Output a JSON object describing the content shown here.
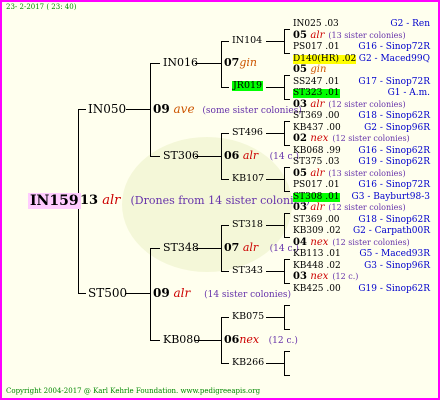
{
  "header": {
    "date": "23-  2-2017 ( 23: 40)"
  },
  "root": {
    "id": "IN159",
    "year": "13",
    "race": "alr",
    "note": "(Drones from 14 sister colonies)"
  },
  "g2": {
    "top": {
      "id": "IN050",
      "year": "09",
      "race": "ave",
      "note": "(some sister colonies)"
    },
    "bottom": {
      "id": "ST500",
      "year": "09",
      "race": "alr",
      "note": "(14 sister colonies)"
    }
  },
  "g3": [
    {
      "id": "IN016",
      "year": "07",
      "race": "gin",
      "note": ""
    },
    {
      "id": "ST306",
      "year": "06",
      "race": "alr",
      "note": "(14 c.)"
    },
    {
      "id": "ST348",
      "year": "07",
      "race": "alr",
      "note": "(14 c.)"
    },
    {
      "id": "KB080",
      "year": "06",
      "race": "nex",
      "note": "(12 c.)"
    }
  ],
  "g4": [
    "IN104",
    "JR019",
    "ST496",
    "KB107",
    "ST318",
    "ST343",
    "KB075",
    "KB266"
  ],
  "right_rows": [
    {
      "kind": "leaf",
      "code": "IN025",
      "yr": ".03",
      "origin": "G2 - Ren"
    },
    {
      "kind": "mid",
      "year": "05",
      "race": "alr",
      "note": "(13 sister colonies)"
    },
    {
      "kind": "leaf",
      "code": "PS017",
      "yr": ".01",
      "origin": "G16 - Sinop72R"
    },
    {
      "kind": "leaf",
      "code": "D140(HR)",
      "yr": ".02",
      "origin": "G2 - Maced99Q",
      "hl": "y"
    },
    {
      "kind": "mid",
      "year": "05",
      "race": "gin",
      "note": ""
    },
    {
      "kind": "leaf",
      "code": "SS247",
      "yr": ".01",
      "origin": "G17 - Sinop72R"
    },
    {
      "kind": "leaf",
      "code": "ST323",
      "yr": ".01",
      "origin": "G1 - A.m.",
      "hl": "g"
    },
    {
      "kind": "mid",
      "year": "03",
      "race": "alr",
      "note": "(12 sister colonies)"
    },
    {
      "kind": "leaf",
      "code": "ST369",
      "yr": ".00",
      "origin": "G18 - Sinop62R"
    },
    {
      "kind": "leaf",
      "code": "KB437",
      "yr": ".00",
      "origin": "G2 - Sinop96R"
    },
    {
      "kind": "mid",
      "year": "02",
      "race": "nex",
      "note": "(12 sister colonies)"
    },
    {
      "kind": "leaf",
      "code": "KB068",
      "yr": ".99",
      "origin": "G16 - Sinop62R"
    },
    {
      "kind": "leaf",
      "code": "ST375",
      "yr": ".03",
      "origin": "G19 - Sinop62R"
    },
    {
      "kind": "mid",
      "year": "05",
      "race": "alr",
      "note": "(13 sister colonies)"
    },
    {
      "kind": "leaf",
      "code": "PS017",
      "yr": ".01",
      "origin": "G16 - Sinop72R"
    },
    {
      "kind": "leaf",
      "code": "ST308",
      "yr": ".01",
      "origin": "G3 - Bayburt98-3",
      "hl": "g"
    },
    {
      "kind": "mid",
      "year": "03",
      "race": "alr",
      "note": "(12 sister colonies)"
    },
    {
      "kind": "leaf",
      "code": "ST369",
      "yr": ".00",
      "origin": "G18 - Sinop62R"
    },
    {
      "kind": "leaf",
      "code": "KB309",
      "yr": ".02",
      "origin": "G2 - Carpath00R"
    },
    {
      "kind": "mid",
      "year": "04",
      "race": "nex",
      "note": "(12 sister colonies)"
    },
    {
      "kind": "leaf",
      "code": "KB113",
      "yr": ".01",
      "origin": "G5 - Maced93R"
    },
    {
      "kind": "leaf",
      "code": "KB448",
      "yr": ".02",
      "origin": "G3 - Sinop96R"
    },
    {
      "kind": "mid",
      "year": "03",
      "race": "nex",
      "note": "(12 c.)"
    },
    {
      "kind": "leaf",
      "code": "KB425",
      "yr": ".00",
      "origin": "G19 - Sinop62R"
    }
  ],
  "footer": {
    "copyright": "Copyright 2004-2017 @ Karl Kehrle Foundation.   www.pedigreeapis.org"
  }
}
